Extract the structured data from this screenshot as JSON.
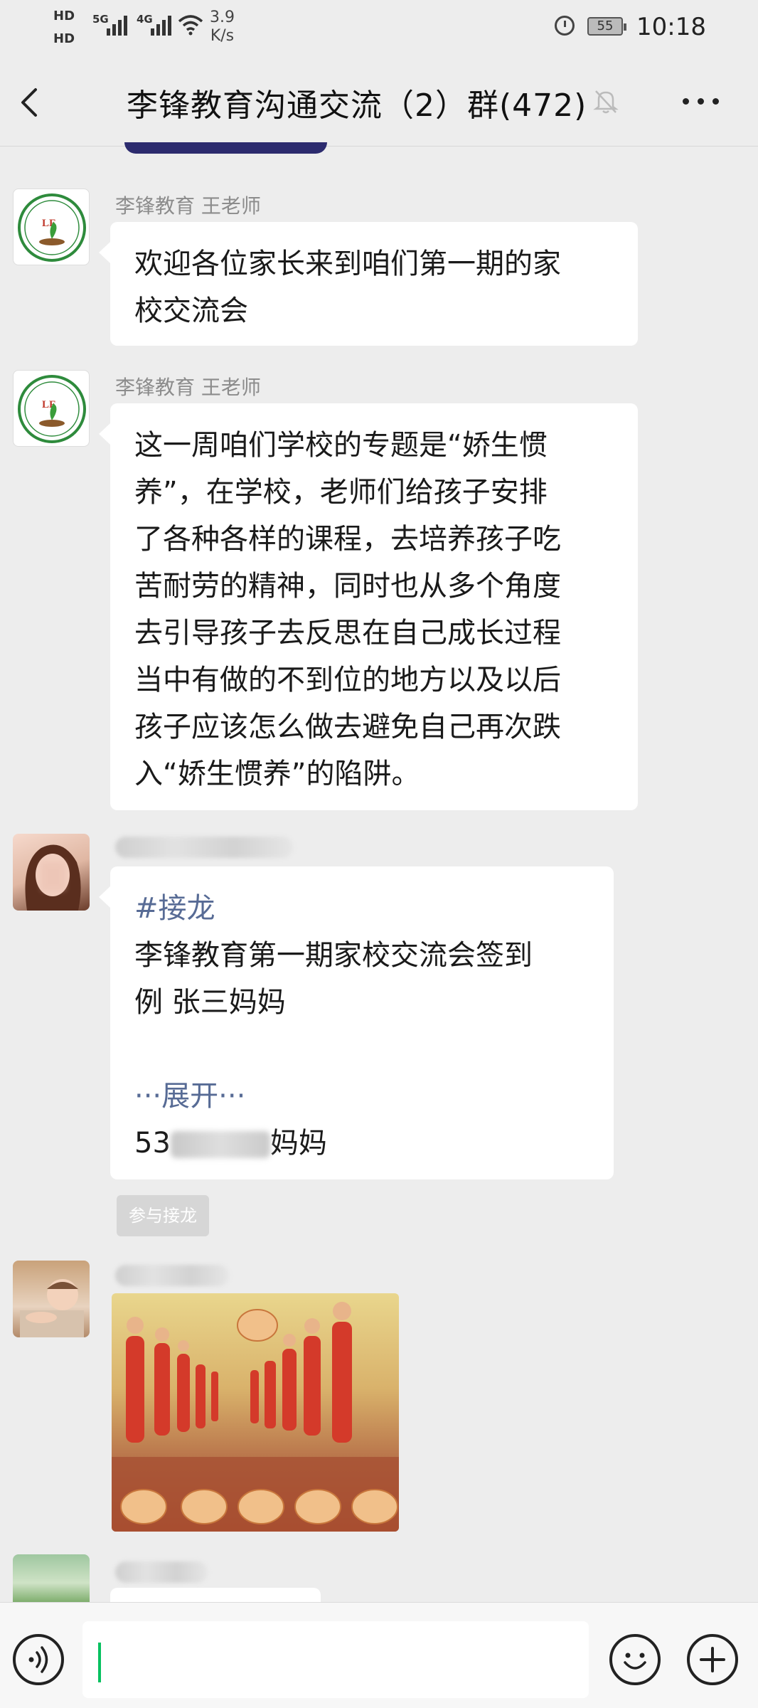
{
  "status_bar": {
    "hd1": "HD",
    "hd2": "HD",
    "net_5g": "5G",
    "net_4g": "4G",
    "speed_value": "3.9",
    "speed_unit": "K/s",
    "battery": "55",
    "time": "10:18"
  },
  "header": {
    "title": "李锋教育沟通交流（2）群(472)",
    "back_icon": "chevron-left-icon",
    "mute_icon": "bell-off-icon",
    "more_icon": "more-dots-icon"
  },
  "messages": [
    {
      "sender": "李锋教育 王老师",
      "avatar_logo_text": "LF",
      "lines": [
        "欢迎各位家长来到咱们第一期的家",
        "校交流会"
      ]
    },
    {
      "sender": "李锋教育 王老师",
      "avatar_logo_text": "LF",
      "lines": [
        "这一周咱们学校的专题是“娇生惯",
        "养”，在学校，老师们给孩子安排",
        "了各种各样的课程，去培养孩子吃",
        "苦耐劳的精神，同时也从多个角度",
        "去引导孩子去反思在自己成长过程",
        "当中有做的不到位的地方以及以后",
        "孩子应该怎么做去避免自己再次跌",
        "入“娇生惯养”的陷阱。"
      ]
    },
    {
      "tag": "#接龙",
      "lines": [
        "李锋教育第一期家校交流会签到",
        "例 张三妈妈"
      ],
      "expand": "···展开···",
      "entry_prefix": "53",
      "entry_suffix": "妈妈",
      "join_button": "参与接龙"
    }
  ],
  "input_bar": {
    "voice_icon": "voice-icon",
    "emoji_icon": "emoji-icon",
    "plus_icon": "plus-icon"
  }
}
